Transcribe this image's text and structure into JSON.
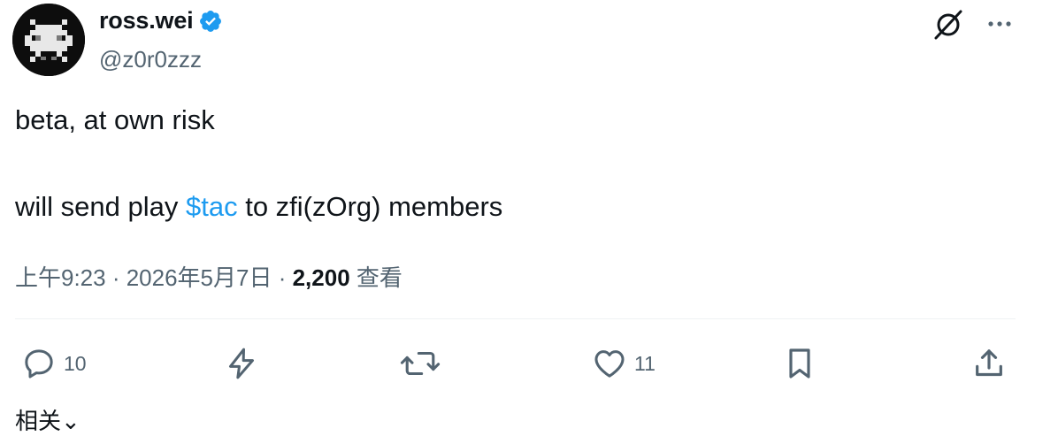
{
  "author": {
    "display_name": "ross.wei",
    "handle": "@z0r0zzz",
    "verified": true,
    "verified_color": "#1d9bf0",
    "avatar_icon": "pixel-invader-avatar"
  },
  "header_icons": [
    "grok-icon",
    "more-options-icon"
  ],
  "tweet": {
    "line1": "beta, at own risk",
    "line2_before": "will send play ",
    "cashtag": "$tac",
    "line2_after": " to zfi(zOrg) members"
  },
  "meta": {
    "time": "上午9:23",
    "separator1": " · ",
    "date": "2026年5月7日",
    "separator2": " · ",
    "views_count": "2,200",
    "views_label": " 查看"
  },
  "actions": {
    "reply_count": "10",
    "like_count": "11",
    "icons": [
      "reply-icon",
      "lightning-icon",
      "retweet-icon",
      "like-icon",
      "bookmark-icon",
      "share-icon"
    ]
  },
  "related": {
    "label": "相关",
    "chevron": "⌄"
  },
  "colors": {
    "text": "#0f1419",
    "secondary": "#536471",
    "link": "#1d9bf0",
    "divider": "#eff3f4"
  }
}
